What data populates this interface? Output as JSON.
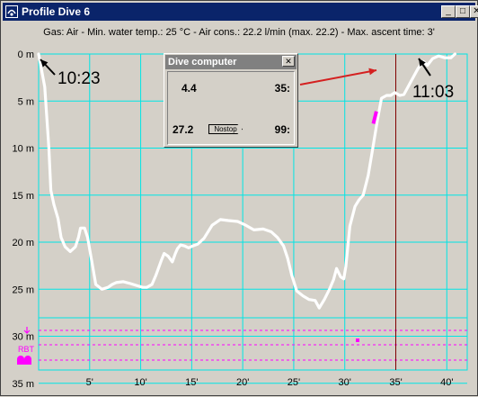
{
  "window": {
    "title": "Profile Dive 6",
    "minimize": "_",
    "maximize": "□",
    "close": "✕"
  },
  "info": {
    "text": "Gas: Air  -  Min. water temp.: 25 °C  -  Air cons.: 22.2 l/min (max. 22.2)  -  Max. ascent time: 3'"
  },
  "labels": {
    "start_time": "10:23",
    "end_time": "11:03",
    "rbt": "RBT"
  },
  "dive_computer": {
    "title": "Dive computer",
    "close": "✕",
    "depth": "4.4",
    "time": "35:",
    "temp": "27.2",
    "status": "Nostop",
    "ndl": "99:"
  },
  "colors": {
    "grid": "#00e5e5",
    "profile": "#ffffff",
    "cursor": "#800000",
    "marker": "#ff00ff",
    "arrow_red": "#d42020"
  },
  "chart_data": {
    "type": "line",
    "title": "",
    "xlabel": "",
    "ylabel": "",
    "xlim": [
      0,
      42
    ],
    "ylim": [
      0,
      40
    ],
    "y_inverted": true,
    "y_ticks": [
      0,
      5,
      10,
      15,
      20,
      25,
      30,
      35
    ],
    "y_tick_labels": [
      "0 m",
      "5 m",
      "10 m",
      "15 m",
      "20 m",
      "25 m",
      "30 m",
      "35 m"
    ],
    "x_ticks": [
      5,
      10,
      15,
      20,
      25,
      30,
      35,
      40
    ],
    "x_tick_labels": [
      "5'",
      "10'",
      "15'",
      "20'",
      "25'",
      "30'",
      "35'",
      "40'"
    ],
    "cursor_time": 35,
    "series": [
      {
        "x": [
          0,
          0.6,
          1,
          1.2,
          1.5,
          1.9,
          2.2,
          2.6,
          3.1,
          3.6,
          3.9,
          4.1,
          4.5,
          4.8,
          5.2,
          5.6,
          6.2,
          6.8,
          7.2,
          7.6,
          8.3,
          9.0,
          9.6,
          10.2,
          10.6,
          11.1,
          11.5,
          12.0,
          12.3,
          12.7,
          13.1,
          13.4,
          13.6,
          13.9,
          14.3,
          14.7,
          15.1,
          15.6,
          16.2,
          17.0,
          17.8,
          18.6,
          19.5,
          20.3,
          21.1,
          22.0,
          22.8,
          23.4,
          24.0,
          24.4,
          24.8,
          25.3,
          25.9,
          26.5,
          27.1,
          27.5,
          28.0,
          28.5,
          28.9,
          29.2,
          29.6,
          29.9,
          30.1,
          30.5,
          31.0,
          31.4,
          31.8,
          32.3,
          32.7,
          33.2,
          33.6,
          34.1,
          34.5,
          34.9,
          35.4,
          35.8,
          36.5,
          37.2,
          37.7,
          38.1,
          38.6,
          39.2,
          39.8,
          40.4,
          40.8
        ],
        "y": [
          0,
          3.5,
          10,
          14.5,
          16,
          17.5,
          19.5,
          20.5,
          21,
          20.5,
          19.5,
          18.5,
          18.5,
          19.5,
          22,
          24.5,
          25,
          24.8,
          24.5,
          24.3,
          24.2,
          24.4,
          24.6,
          24.8,
          24.8,
          24.5,
          23.5,
          22,
          21.2,
          21.5,
          22.1,
          21.2,
          20.7,
          20.3,
          20.4,
          20.6,
          20.4,
          20.2,
          19.6,
          18.2,
          17.6,
          17.7,
          17.8,
          18.2,
          18.7,
          18.6,
          18.9,
          19.5,
          20.4,
          21.7,
          23.5,
          25.2,
          25.7,
          26.1,
          26.2,
          27.0,
          26.1,
          25.0,
          24.0,
          22.8,
          23.7,
          23.9,
          22.6,
          18.3,
          16.2,
          15.5,
          15.0,
          12.9,
          10.3,
          7.0,
          4.7,
          4.4,
          4.4,
          4.1,
          4.4,
          4.3,
          2.9,
          1.5,
          0.8,
          1.2,
          0.5,
          0.2,
          0.4,
          0.4,
          0.0
        ]
      }
    ]
  }
}
